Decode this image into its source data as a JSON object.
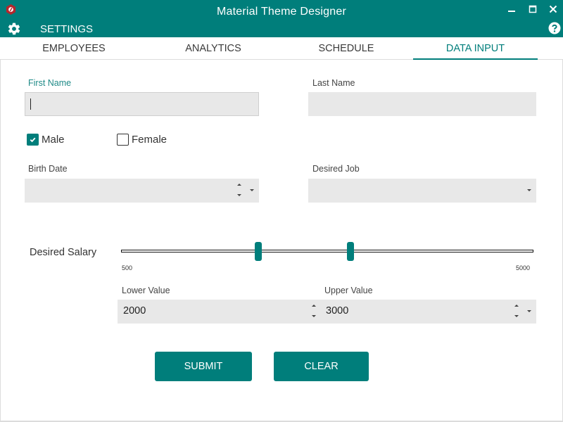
{
  "window": {
    "title": "Material Theme Designer",
    "icons": {
      "app": "app-logo-icon",
      "minimize": "minimize-icon",
      "maximize": "maximize-icon",
      "close": "close-icon"
    }
  },
  "toolbar": {
    "settings_label": "SETTINGS",
    "icons": {
      "settings": "gear-icon",
      "help": "help-icon"
    }
  },
  "tabs": [
    {
      "label": "EMPLOYEES",
      "active": false
    },
    {
      "label": "ANALYTICS",
      "active": false
    },
    {
      "label": "SCHEDULE",
      "active": false
    },
    {
      "label": "DATA INPUT",
      "active": true
    }
  ],
  "form": {
    "first_name": {
      "label": "First Name",
      "value": "",
      "focused": true
    },
    "last_name": {
      "label": "Last Name",
      "value": ""
    },
    "gender": [
      {
        "label": "Male",
        "checked": true
      },
      {
        "label": "Female",
        "checked": false
      }
    ],
    "birth_date": {
      "label": "Birth Date",
      "value": ""
    },
    "desired_job": {
      "label": "Desired Job",
      "value": ""
    },
    "salary": {
      "label": "Desired Salary",
      "min": 500,
      "max": 5000,
      "min_label": "500",
      "max_label": "5000",
      "lower": 2000,
      "upper": 3000,
      "lower_label": "Lower Value",
      "upper_label": "Upper Value",
      "lower_text": "2000",
      "upper_text": "3000"
    },
    "buttons": {
      "submit": "SUBMIT",
      "clear": "CLEAR"
    }
  },
  "colors": {
    "accent": "#007e7b",
    "field_bg": "#e8e8e8",
    "focused_label": "#1f8a87"
  }
}
